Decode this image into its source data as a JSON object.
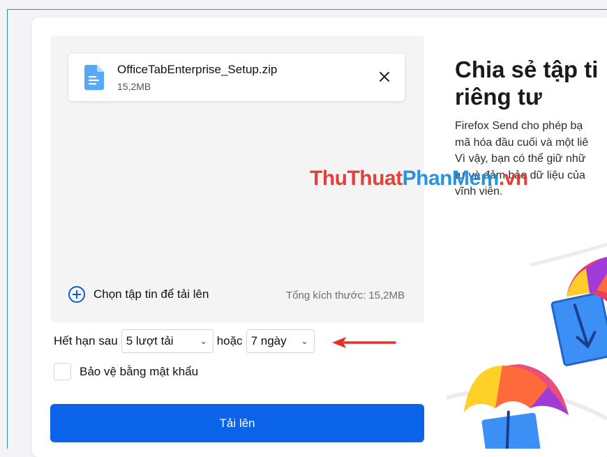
{
  "upload": {
    "file": {
      "name": "OfficeTabEnterprise_Setup.zip",
      "size": "15,2MB",
      "icon": "file-document-icon",
      "remove_icon": "close-icon"
    },
    "add_files_label": "Chọn tập tin để tải lên",
    "total_size": "Tổng kích thước: 15,2MB"
  },
  "expiry": {
    "prefix": "Hết hạn sau",
    "downloads_value": "5 lượt tải",
    "connector": "hoặc",
    "days_value": "7 ngày"
  },
  "password": {
    "label": "Bảo vệ bằng mật khẩu",
    "checked": false
  },
  "upload_button": {
    "label": "Tải lên"
  },
  "intro": {
    "title_line1": "Chia sẻ tập ti",
    "title_line2": "riêng tư",
    "desc_lines": [
      "Firefox Send cho phép bạ",
      "mã hóa đầu cuối và một liê",
      "Vì vậy, bạn có thể giữ nhữ",
      "tư và đảm bảo dữ liệu của",
      "vĩnh viễn."
    ]
  },
  "watermark": {
    "part1": "ThuThuat",
    "part2": "PhanMem",
    "part3": ".vn"
  },
  "colors": {
    "accent": "#0a63e8",
    "annotation_arrow": "#e0322b",
    "frame": "#1aa38a"
  }
}
